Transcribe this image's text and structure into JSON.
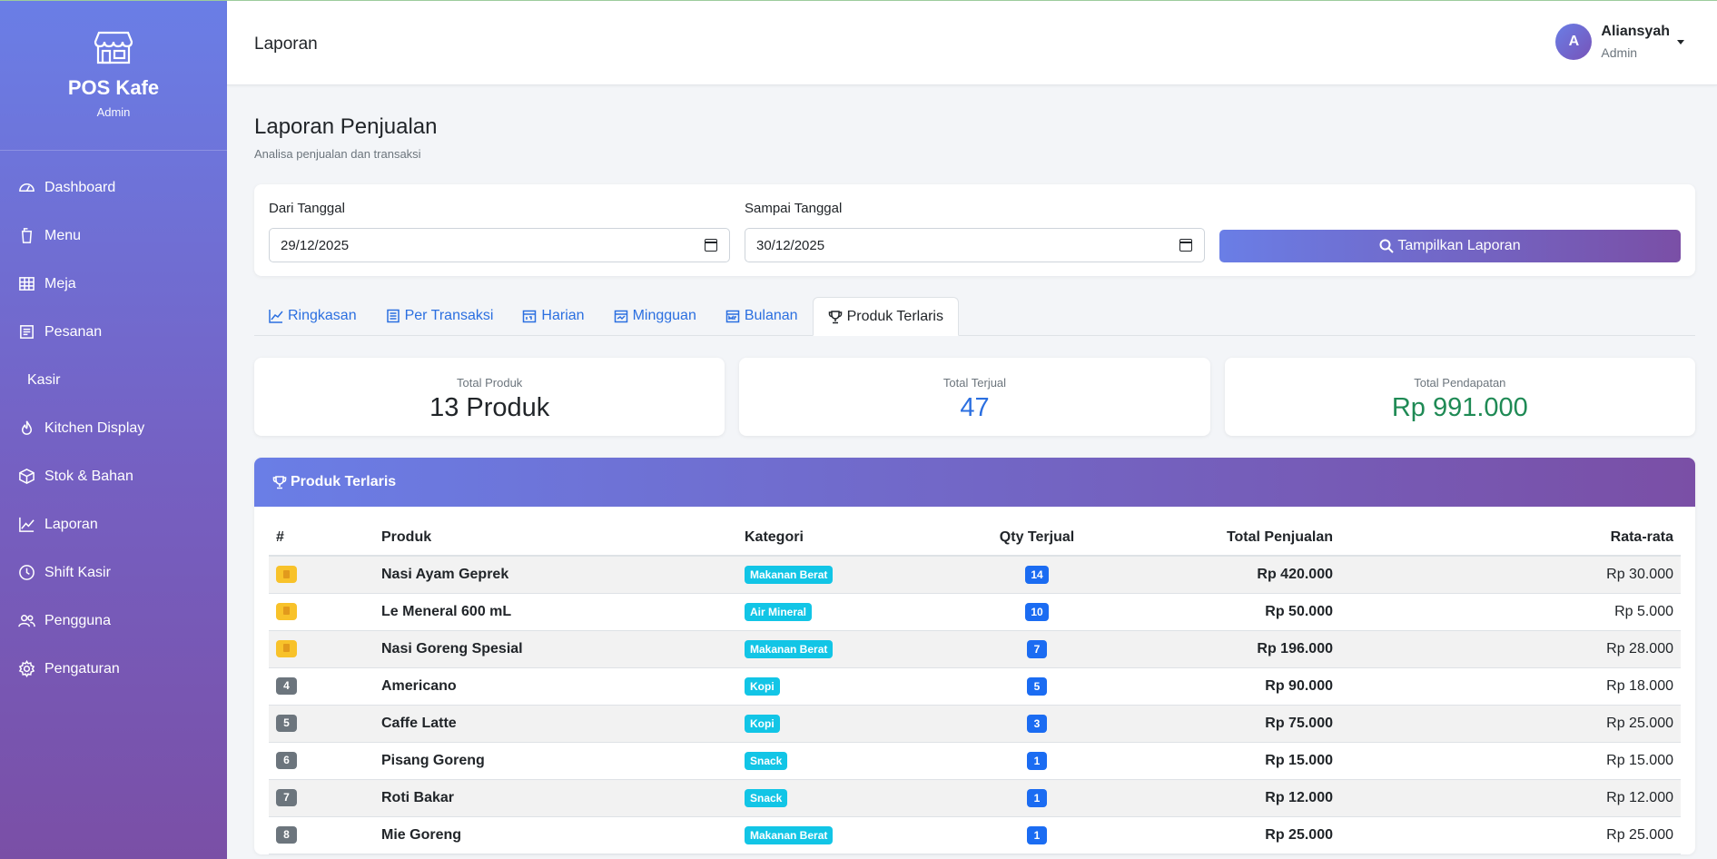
{
  "brand": {
    "title": "POS Kafe",
    "subtitle": "Admin"
  },
  "sidebar": {
    "items": [
      {
        "label": "Dashboard",
        "icon": "speedometer-icon"
      },
      {
        "label": "Menu",
        "icon": "cup-icon"
      },
      {
        "label": "Meja",
        "icon": "table-icon"
      },
      {
        "label": "Pesanan",
        "icon": "receipt-icon"
      },
      {
        "label": "Kasir",
        "icon": ""
      },
      {
        "label": "Kitchen Display",
        "icon": "fire-icon"
      },
      {
        "label": "Stok & Bahan",
        "icon": "box-icon"
      },
      {
        "label": "Laporan",
        "icon": "chart-line-icon"
      },
      {
        "label": "Shift Kasir",
        "icon": "clock-icon"
      },
      {
        "label": "Pengguna",
        "icon": "people-icon"
      },
      {
        "label": "Pengaturan",
        "icon": "gear-icon"
      }
    ]
  },
  "topbar": {
    "title": "Laporan"
  },
  "user": {
    "initial": "A",
    "name": "Aliansyah",
    "role": "Admin"
  },
  "page": {
    "title": "Laporan Penjualan",
    "subtitle": "Analisa penjualan dan transaksi"
  },
  "filter": {
    "from_label": "Dari Tanggal",
    "from_value": "29/12/2025",
    "to_label": "Sampai Tanggal",
    "to_value": "30/12/2025",
    "button_label": "Tampilkan Laporan"
  },
  "tabs": [
    {
      "label": "Ringkasan",
      "icon": "graph-up-icon"
    },
    {
      "label": "Per Transaksi",
      "icon": "list-icon"
    },
    {
      "label": "Harian",
      "icon": "calendar-day-icon"
    },
    {
      "label": "Mingguan",
      "icon": "calendar-week-icon"
    },
    {
      "label": "Bulanan",
      "icon": "calendar-month-icon"
    },
    {
      "label": "Produk Terlaris",
      "icon": "trophy-icon",
      "active": true
    }
  ],
  "stats": [
    {
      "label": "Total Produk",
      "value": "13 Produk"
    },
    {
      "label": "Total Terjual",
      "value": "47"
    },
    {
      "label": "Total Pendapatan",
      "value": "Rp 991.000"
    }
  ],
  "table": {
    "title": "Produk Terlaris",
    "headers": [
      "#",
      "Produk",
      "Kategori",
      "Qty Terjual",
      "Total Penjualan",
      "Rata-rata"
    ],
    "rows": [
      {
        "rank": "",
        "medal": true,
        "product": "Nasi Ayam Geprek",
        "category": "Makanan Berat",
        "qty": "14",
        "total": "Rp 420.000",
        "avg": "Rp 30.000"
      },
      {
        "rank": "",
        "medal": true,
        "product": "Le Meneral 600 mL",
        "category": "Air Mineral",
        "qty": "10",
        "total": "Rp 50.000",
        "avg": "Rp 5.000"
      },
      {
        "rank": "",
        "medal": true,
        "product": "Nasi Goreng Spesial",
        "category": "Makanan Berat",
        "qty": "7",
        "total": "Rp 196.000",
        "avg": "Rp 28.000"
      },
      {
        "rank": "4",
        "medal": false,
        "product": "Americano",
        "category": "Kopi",
        "qty": "5",
        "total": "Rp 90.000",
        "avg": "Rp 18.000"
      },
      {
        "rank": "5",
        "medal": false,
        "product": "Caffe Latte",
        "category": "Kopi",
        "qty": "3",
        "total": "Rp 75.000",
        "avg": "Rp 25.000"
      },
      {
        "rank": "6",
        "medal": false,
        "product": "Pisang Goreng",
        "category": "Snack",
        "qty": "1",
        "total": "Rp 15.000",
        "avg": "Rp 15.000"
      },
      {
        "rank": "7",
        "medal": false,
        "product": "Roti Bakar",
        "category": "Snack",
        "qty": "1",
        "total": "Rp 12.000",
        "avg": "Rp 12.000"
      },
      {
        "rank": "8",
        "medal": false,
        "product": "Mie Goreng",
        "category": "Makanan Berat",
        "qty": "1",
        "total": "Rp 25.000",
        "avg": "Rp 25.000"
      }
    ]
  },
  "colors": {
    "gradient_start": "#6a7ee6",
    "gradient_end": "#7a4fa6",
    "link_blue": "#2b6fe0",
    "revenue_green": "#1f8a55"
  }
}
